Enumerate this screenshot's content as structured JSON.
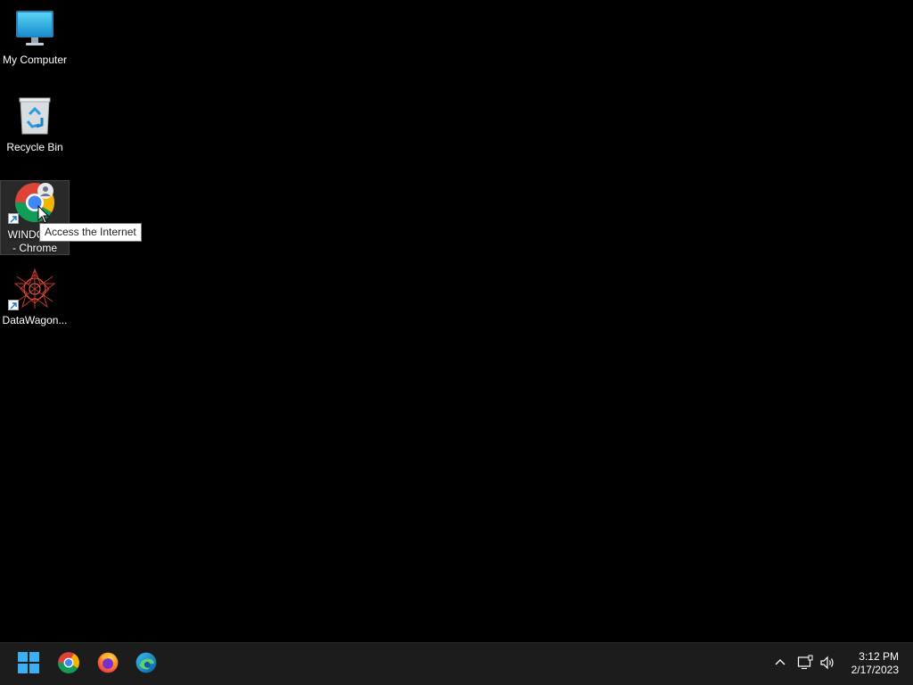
{
  "desktop": {
    "background_color": "#000000",
    "icons": [
      {
        "label": "My Computer",
        "icon": "monitor-icon"
      },
      {
        "label": "Recycle Bin",
        "icon": "recycle-bin-icon"
      },
      {
        "label": "WINDOWS\n- Chrome",
        "icon": "chrome-icon"
      },
      {
        "label": "DataWagon...",
        "icon": "datawagon-icon"
      }
    ],
    "tooltip": "Access the Internet"
  },
  "taskbar": {
    "background_color": "#1c1c1c",
    "apps": [
      {
        "name": "start-button",
        "icon": "windows-logo-icon"
      },
      {
        "name": "chrome",
        "icon": "chrome-icon"
      },
      {
        "name": "firefox",
        "icon": "firefox-icon"
      },
      {
        "name": "edge",
        "icon": "edge-icon"
      }
    ],
    "tray": {
      "icons": [
        "chevron-up-icon",
        "network-icon",
        "volume-icon"
      ],
      "time": "3:12 PM",
      "date": "2/17/2023"
    }
  },
  "colors": {
    "windows_blue": "#0078d4",
    "chrome_red": "#db4437",
    "chrome_green": "#0f9d58",
    "chrome_yellow": "#f4b400",
    "chrome_blue": "#4285f4"
  }
}
